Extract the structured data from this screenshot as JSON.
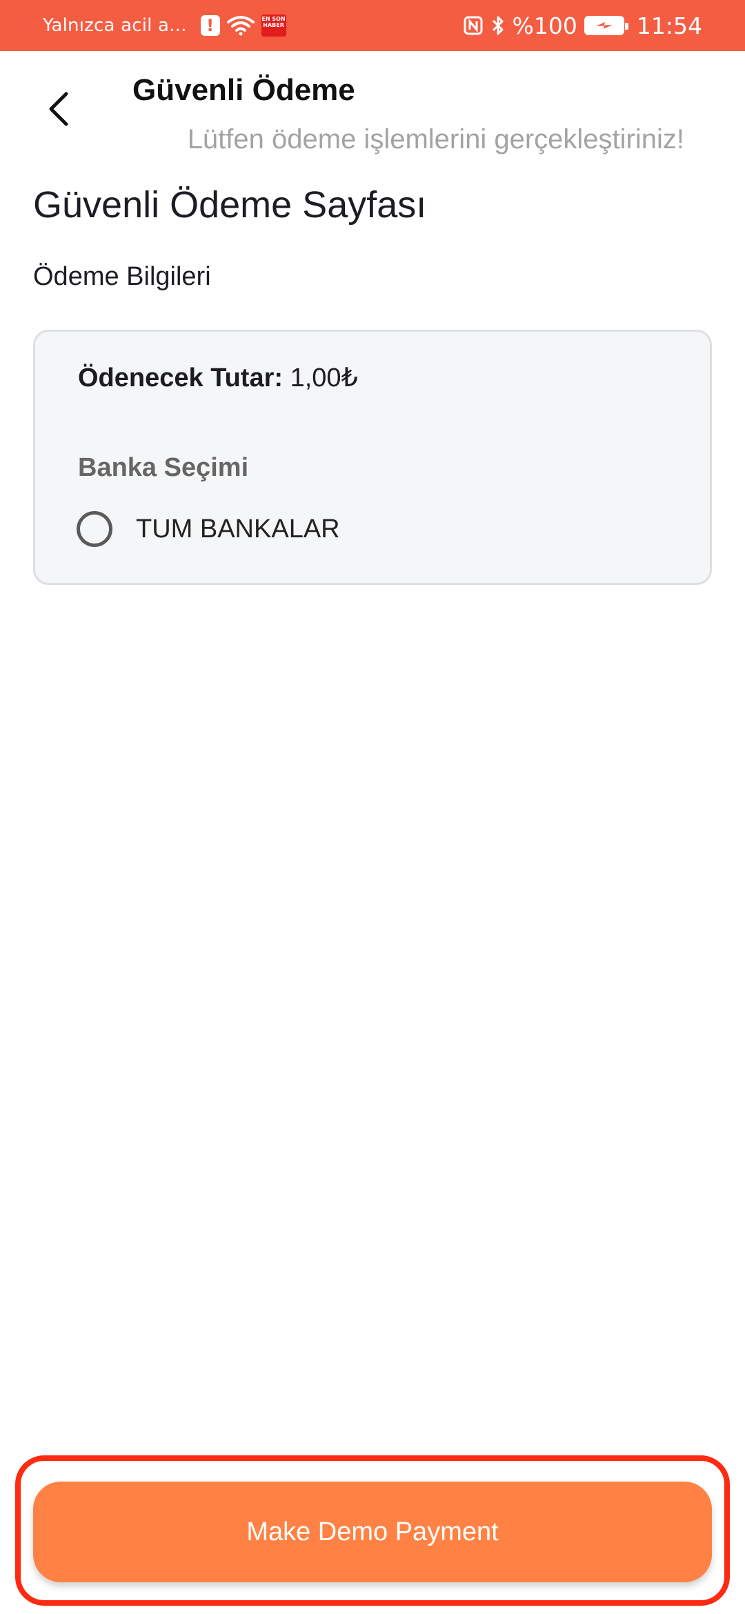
{
  "status_bar": {
    "notification_text": "Yalnızca acil a...",
    "alert_glyph": "!",
    "news_badge": "EN SON HABER",
    "battery_text": "%100",
    "time": "11:54",
    "icons": [
      "alert-icon",
      "wifi-icon",
      "news-app-icon",
      "nfc-icon",
      "bluetooth-icon",
      "battery-icon"
    ]
  },
  "header": {
    "title": "Güvenli Ödeme",
    "subtitle": "Lütfen ödeme işlemlerini gerçekleştiriniz!",
    "back_icon": "chevron-left-icon"
  },
  "page": {
    "title": "Güvenli Ödeme Sayfası",
    "section_label": "Ödeme Bilgileri"
  },
  "card": {
    "amount_label": "Ödenecek Tutar:",
    "amount_value": "1,00₺",
    "bank_label": "Banka Seçimi",
    "bank_options": [
      {
        "label": "TUM BANKALAR",
        "selected": false
      }
    ]
  },
  "footer": {
    "button_label": "Make Demo Payment"
  },
  "colors": {
    "status_bar": "#f45d42",
    "button": "#ff8244",
    "highlight": "#ff2a12",
    "card_bg": "#f5f6f8"
  }
}
